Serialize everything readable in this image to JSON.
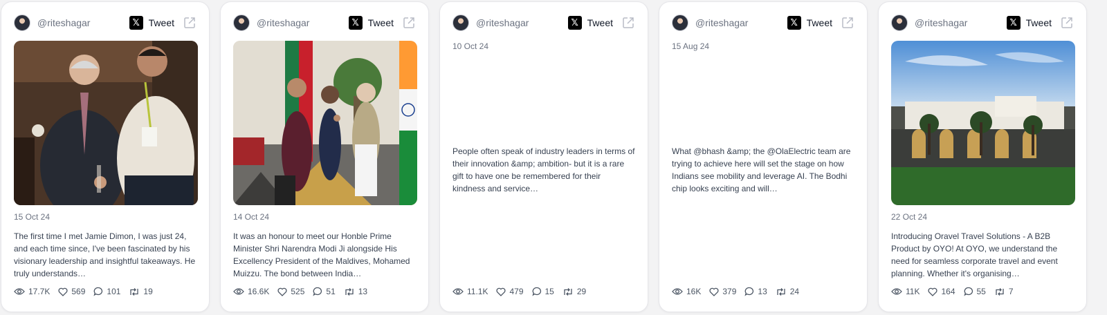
{
  "cards": [
    {
      "handle": "@riteshagar",
      "tweet_label": "Tweet",
      "date": "15 Oct 24",
      "text": "The first time I met Jamie Dimon, I was just 24, and each time since, I've been fascinated by his visionary leadership and insightful takeaways. He truly understands…",
      "views": "17.7K",
      "likes": "569",
      "replies": "101",
      "retweets": "19",
      "has_image": true,
      "image_subject": "two-men-event-photo"
    },
    {
      "handle": "@riteshagar",
      "tweet_label": "Tweet",
      "date": "14 Oct 24",
      "text": "It was an honour to meet our Honble Prime Minister Shri Narendra Modi Ji alongside His Excellency President of the Maldives, Mohamed Muizzu. The bond between India…",
      "views": "16.6K",
      "likes": "525",
      "replies": "51",
      "retweets": "13",
      "has_image": true,
      "image_subject": "handshake-with-flags-photo"
    },
    {
      "handle": "@riteshagar",
      "tweet_label": "Tweet",
      "date": "10 Oct 24",
      "text": "People often speak of industry leaders in terms of their innovation &amp; ambition- but it is a rare gift to have one be remembered for their kindness and service…",
      "views": "11.1K",
      "likes": "479",
      "replies": "15",
      "retweets": "29",
      "has_image": false
    },
    {
      "handle": "@riteshagar",
      "tweet_label": "Tweet",
      "date": "15 Aug 24",
      "text": "What @bhash &amp; the @OlaElectric team are trying to achieve here will set the stage on how Indians see mobility and leverage AI. The Bodhi chip looks exciting and will…",
      "views": "16K",
      "likes": "379",
      "replies": "13",
      "retweets": "24",
      "has_image": false
    },
    {
      "handle": "@riteshagar",
      "tweet_label": "Tweet",
      "date": "22 Oct 24",
      "text": "Introducing Oravel Travel Solutions - A B2B Product by OYO! At OYO, we understand the need for seamless corporate travel and event planning. Whether it's organising…",
      "views": "11K",
      "likes": "164",
      "replies": "55",
      "retweets": "7",
      "has_image": true,
      "image_subject": "hotel-building-dusk-photo"
    }
  ],
  "colors": {
    "page_bg": "#f3f3f4",
    "card_bg": "#ffffff",
    "muted_text": "#6b7280",
    "body_text": "#374151",
    "x_logo_bg": "#000000"
  }
}
